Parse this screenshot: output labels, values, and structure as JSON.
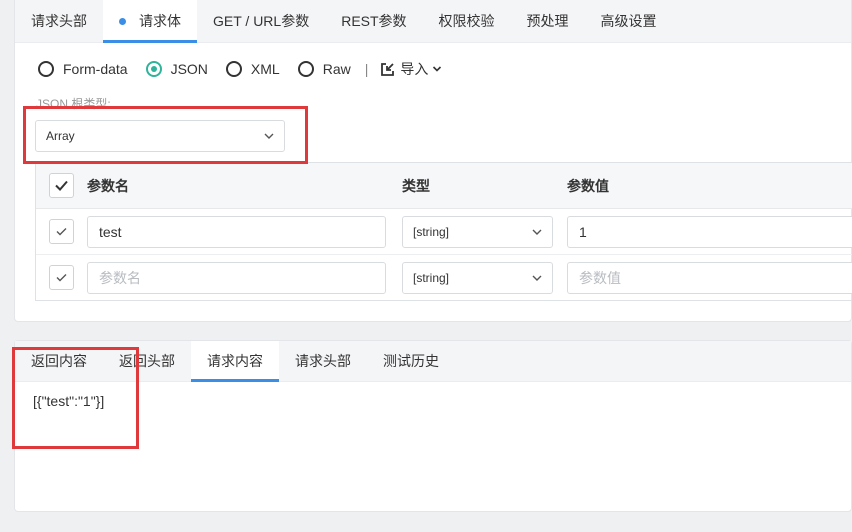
{
  "top_tabs": [
    {
      "label": "请求头部"
    },
    {
      "label": "请求体"
    },
    {
      "label": "GET / URL参数"
    },
    {
      "label": "REST参数"
    },
    {
      "label": "权限校验"
    },
    {
      "label": "预处理"
    },
    {
      "label": "高级设置"
    }
  ],
  "body_types": [
    {
      "label": "Form-data"
    },
    {
      "label": "JSON"
    },
    {
      "label": "XML"
    },
    {
      "label": "Raw"
    }
  ],
  "selected_body_type": "JSON",
  "separator": "|",
  "import_label": "导入",
  "json_root_label": "JSON 根类型:",
  "json_root_value": "Array",
  "table": {
    "headers": {
      "name": "参数名",
      "type": "类型",
      "value": "参数值"
    },
    "rows": [
      {
        "name": "test",
        "type": "[string]",
        "value": "1"
      },
      {
        "name_placeholder": "参数名",
        "type": "[string]",
        "value_placeholder": "参数值"
      }
    ]
  },
  "bottom_tabs": [
    {
      "label": "返回内容"
    },
    {
      "label": "返回头部"
    },
    {
      "label": "请求内容"
    },
    {
      "label": "请求头部"
    },
    {
      "label": "测试历史"
    }
  ],
  "request_content": "[{\"test\":\"1\"}]",
  "colors": {
    "accent": "#3a8ee6",
    "radio_checked": "#2fb39b",
    "highlight_box": "#e0393b",
    "background": "#eef0f2"
  }
}
